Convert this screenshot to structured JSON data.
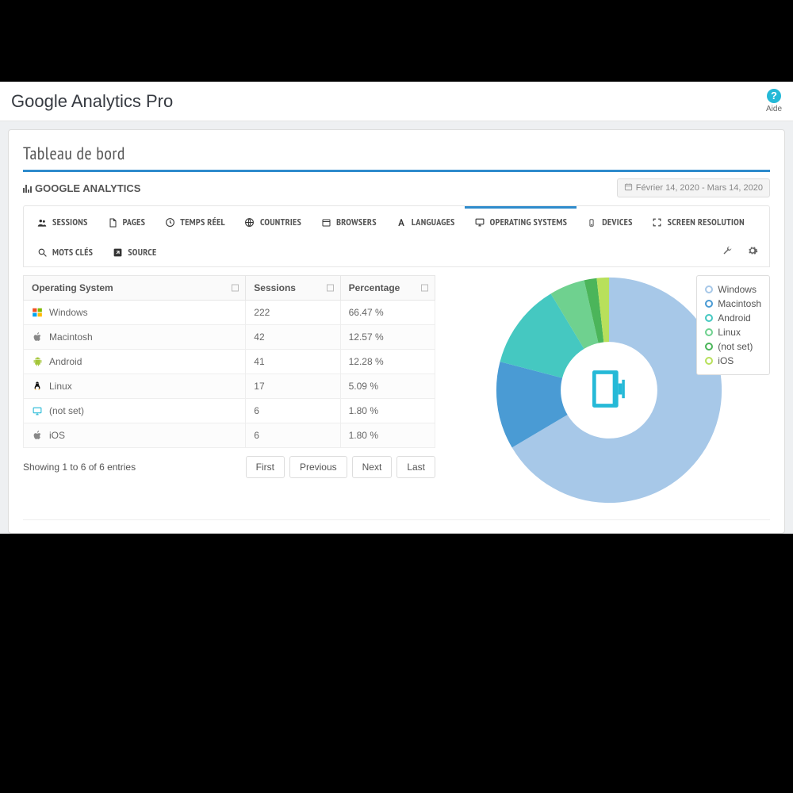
{
  "app_title": "Google Analytics Pro",
  "help_label": "Aide",
  "panel_title": "Tableau de bord",
  "section_label": "GOOGLE ANALYTICS",
  "date_range": "Février 14, 2020 - Mars 14, 2020",
  "tabs": [
    {
      "label": "SESSIONS"
    },
    {
      "label": "PAGES"
    },
    {
      "label": "TEMPS RÉEL"
    },
    {
      "label": "COUNTRIES"
    },
    {
      "label": "BROWSERS"
    },
    {
      "label": "LANGUAGES"
    },
    {
      "label": "OPERATING SYSTEMS"
    },
    {
      "label": "DEVICES"
    },
    {
      "label": "SCREEN RESOLUTION"
    },
    {
      "label": "MOTS CLÉS"
    },
    {
      "label": "SOURCE"
    }
  ],
  "table": {
    "columns": [
      "Operating System",
      "Sessions",
      "Percentage"
    ],
    "rows": [
      {
        "os": "Windows",
        "sessions": "222",
        "pct": "66.47 %",
        "color": "#00a4ef"
      },
      {
        "os": "Macintosh",
        "sessions": "42",
        "pct": "12.57 %",
        "color": "#888"
      },
      {
        "os": "Android",
        "sessions": "41",
        "pct": "12.28 %",
        "color": "#a4c639"
      },
      {
        "os": "Linux",
        "sessions": "17",
        "pct": "5.09 %",
        "color": "#111"
      },
      {
        "os": "(not set)",
        "sessions": "6",
        "pct": "1.80 %",
        "color": "#25b9d7"
      },
      {
        "os": "iOS",
        "sessions": "6",
        "pct": "1.80 %",
        "color": "#888"
      }
    ],
    "footer_info": "Showing 1 to 6 of 6 entries",
    "pager": [
      "First",
      "Previous",
      "Next",
      "Last"
    ]
  },
  "chart_data": {
    "type": "pie",
    "title": "",
    "series": [
      {
        "name": "Windows",
        "value": 222,
        "pct": 66.47,
        "color": "#a7c8e8"
      },
      {
        "name": "Macintosh",
        "value": 42,
        "pct": 12.57,
        "color": "#4a9bd4"
      },
      {
        "name": "Android",
        "value": 41,
        "pct": 12.28,
        "color": "#45c8c1"
      },
      {
        "name": "Linux",
        "value": 17,
        "pct": 5.09,
        "color": "#6fd18f"
      },
      {
        "name": "(not set)",
        "value": 6,
        "pct": 1.8,
        "color": "#4bb55a"
      },
      {
        "name": "iOS",
        "value": 6,
        "pct": 1.8,
        "color": "#b8e05b"
      }
    ]
  }
}
